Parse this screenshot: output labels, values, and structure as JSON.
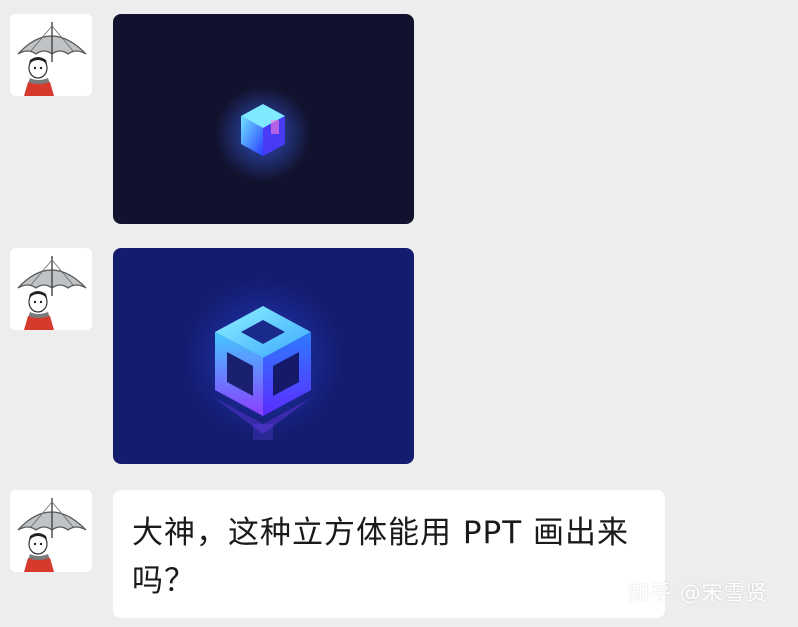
{
  "chat": {
    "messages": [
      {
        "type": "image",
        "sender_avatar": "umbrella-man-avatar",
        "image": "glowing-cube-small"
      },
      {
        "type": "image",
        "sender_avatar": "umbrella-man-avatar",
        "image": "glowing-cube-hollow"
      },
      {
        "type": "text",
        "sender_avatar": "umbrella-man-avatar",
        "text": "大神，这种立方体能用 PPT 画出来吗？"
      }
    ]
  },
  "watermark": {
    "text": "知乎 @宋雪贤"
  },
  "colors": {
    "background": "#ededed",
    "bubble": "#ffffff",
    "image1_bg": "#12122e",
    "image2_bg": "#141c6e"
  }
}
